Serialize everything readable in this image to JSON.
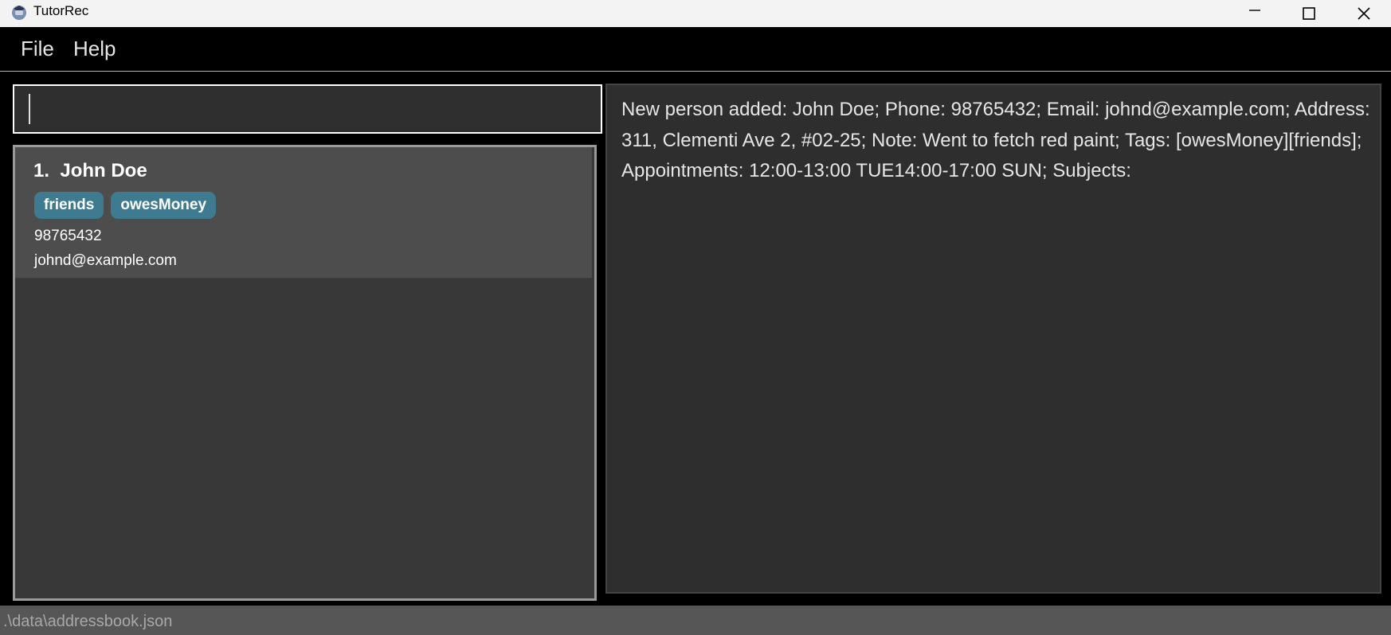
{
  "window": {
    "title": "TutorRec",
    "icon": "app-logo-icon",
    "controls": [
      "minimize-icon",
      "maximize-icon",
      "close-icon"
    ]
  },
  "menu": {
    "file": "File",
    "help": "Help"
  },
  "command_box": {
    "value": "",
    "placeholder": ""
  },
  "person_list": {
    "persons": [
      {
        "index_name": "1.  John Doe",
        "tags": [
          "friends",
          "owesMoney"
        ],
        "phone": "98765432",
        "email": "johnd@example.com"
      }
    ]
  },
  "result_display": {
    "text": "New person added: John Doe; Phone: 98765432; Email: johnd@example.com; Address: 311, Clementi Ave 2, #02-25; Note: Went to fetch red paint; Tags: [owesMoney][friends]; Appointments: 12:00-13:00 TUE14:00-17:00 SUN; Subjects:"
  },
  "status_bar": {
    "path": ".\\data\\addressbook.json"
  },
  "colors": {
    "background": "#000000",
    "panel": "#383838",
    "card": "#4d4d4d",
    "tag": "#3e7b91",
    "statusbar": "#565656"
  }
}
